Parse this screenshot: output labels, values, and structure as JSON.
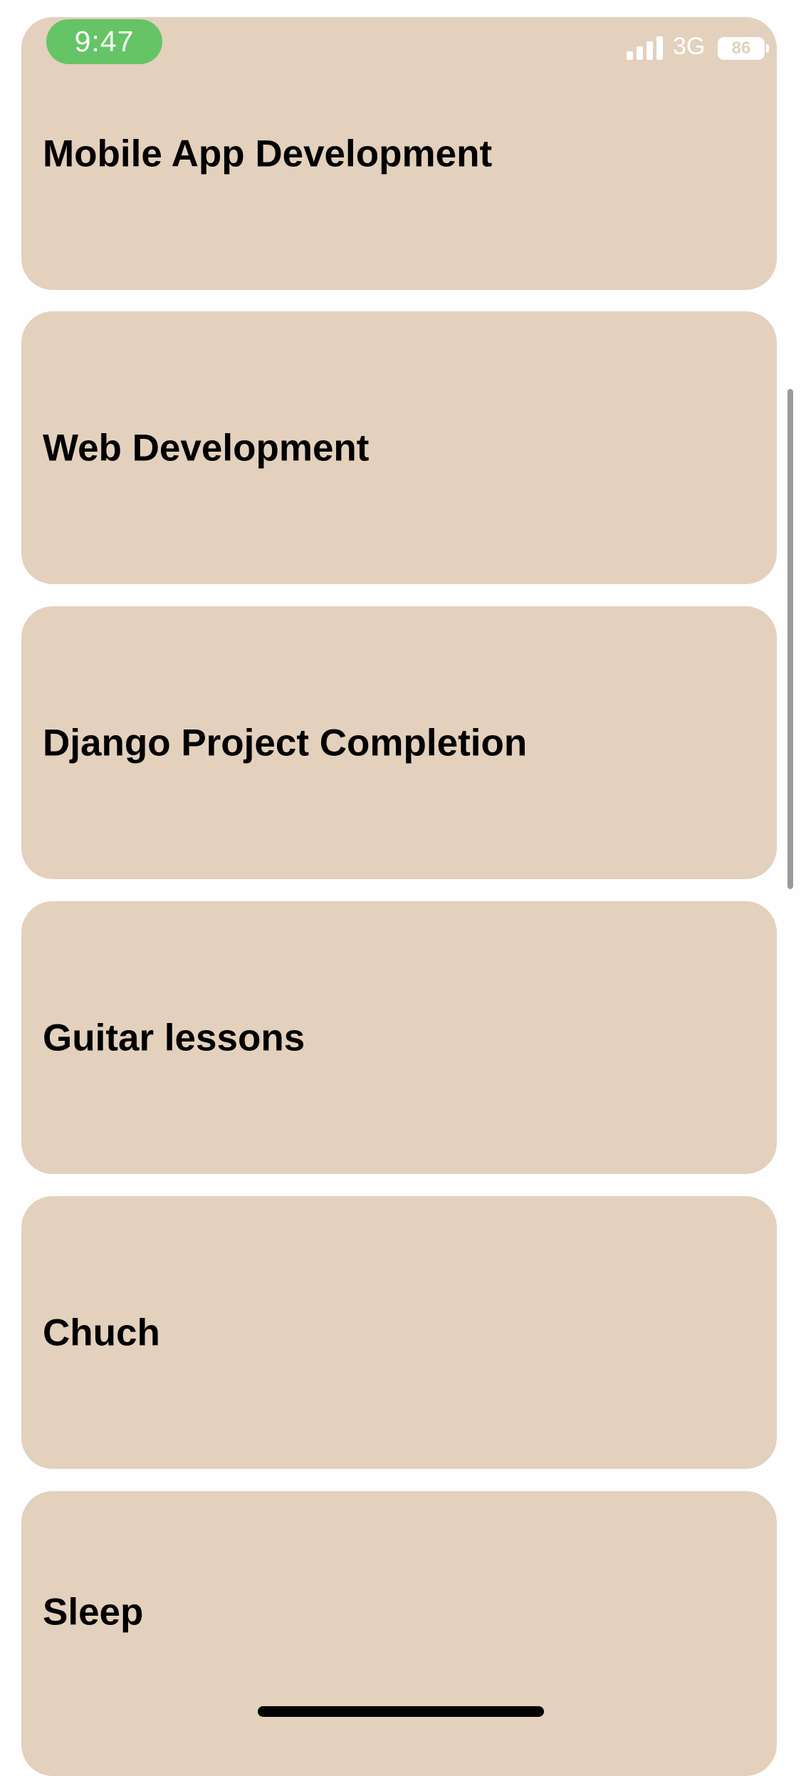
{
  "status_bar": {
    "time": "9:47",
    "network": "3G",
    "battery_level": "86",
    "signal_icon": "signal-bars-icon",
    "time_pill_color": "#65c466"
  },
  "cards": [
    {
      "title": "Mobile App Development"
    },
    {
      "title": "Web Development"
    },
    {
      "title": "Django Project Completion"
    },
    {
      "title": "Guitar lessons"
    },
    {
      "title": "Chuch"
    },
    {
      "title": "Sleep"
    }
  ],
  "colors": {
    "card_background": "#e3d1bd",
    "page_background": "#fefefe",
    "text": "#000000"
  }
}
